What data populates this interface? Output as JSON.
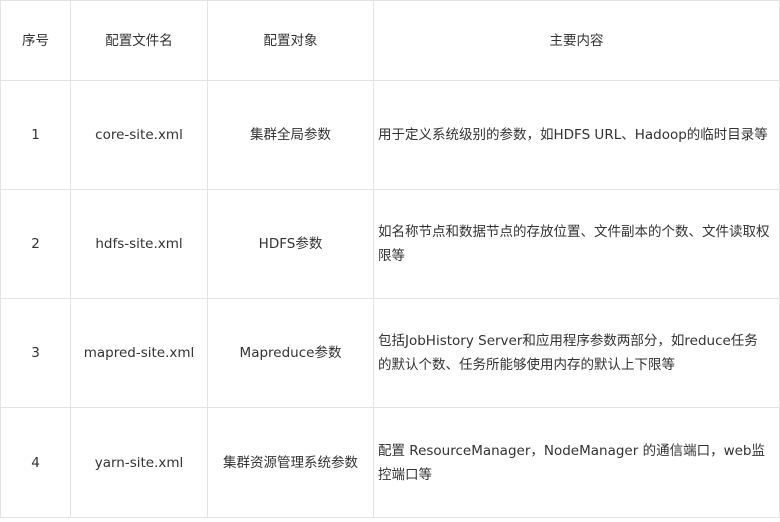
{
  "table": {
    "headers": [
      "序号",
      "配置文件名",
      "配置对象",
      "主要内容"
    ],
    "rows": [
      {
        "index": "1",
        "file": "core-site.xml",
        "target": "集群全局参数",
        "content": "用于定义系统级别的参数，如HDFS  URL、Hadoop的临时目录等"
      },
      {
        "index": "2",
        "file": "hdfs-site.xml",
        "target": "HDFS参数",
        "content": "如名称节点和数据节点的存放位置、文件副本的个数、文件读取权限等"
      },
      {
        "index": "3",
        "file": "mapred-site.xml",
        "target": "Mapreduce参数",
        "content": "包括JobHistory Server和应用程序参数两部分，如reduce任务的默认个数、任务所能够使用内存的默认上下限等"
      },
      {
        "index": "4",
        "file": "yarn-site.xml",
        "target": "集群资源管理系统参数",
        "content": "配置 ResourceManager，NodeManager 的通信端口，web监控端口等"
      }
    ]
  }
}
